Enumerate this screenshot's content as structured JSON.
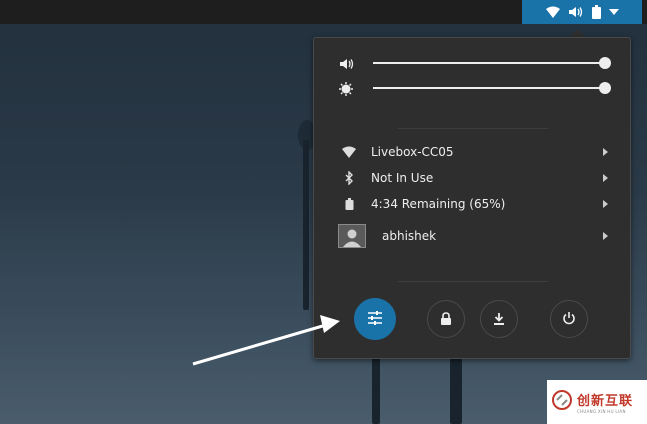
{
  "topbar": {
    "status_icons": [
      "wifi-icon",
      "volume-icon",
      "battery-icon",
      "dropdown-arrow-icon"
    ]
  },
  "system_menu": {
    "volume": {
      "icon": "volume-icon",
      "level": 1.0
    },
    "brightness": {
      "icon": "brightness-icon",
      "level": 1.0
    },
    "items": [
      {
        "icon": "wifi-icon",
        "label": "Livebox-CC05"
      },
      {
        "icon": "bluetooth-icon",
        "label": "Not In Use"
      },
      {
        "icon": "battery-icon",
        "label": "4:34 Remaining (65%)"
      },
      {
        "icon": "user-avatar",
        "label": "abhishek"
      }
    ],
    "buttons": [
      {
        "name": "settings-button",
        "icon": "sliders-icon",
        "active": true
      },
      {
        "name": "lock-button",
        "icon": "lock-icon"
      },
      {
        "name": "suspend-button",
        "icon": "download-icon"
      },
      {
        "name": "power-button",
        "icon": "power-icon"
      }
    ]
  },
  "watermark": {
    "main": "创新互联",
    "sub": "CHUANG XIN HU LIAN"
  },
  "colors": {
    "accent": "#1a73a8",
    "menu_bg": "#2e2e2e",
    "topbar_bg": "#1e1e1e"
  }
}
